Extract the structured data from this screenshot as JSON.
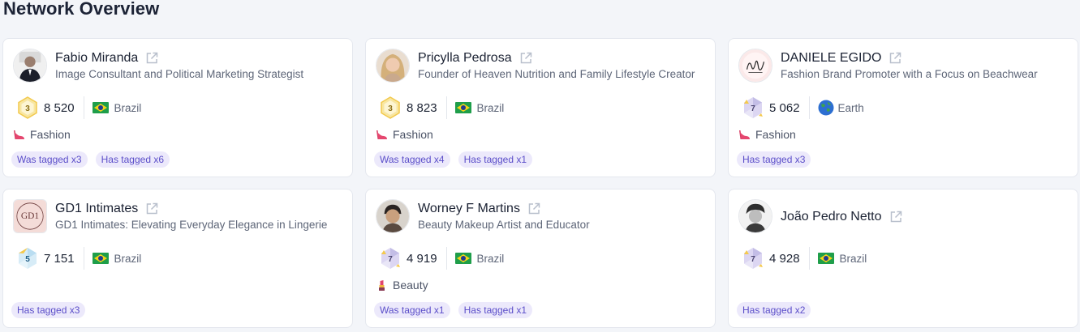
{
  "page": {
    "title": "Network Overview"
  },
  "colors": {
    "tag_bg": "#ece9fb",
    "tag_text": "#5b4ec9",
    "badge_gold": "#f2c94c"
  },
  "cards": [
    {
      "name": "Fabio Miranda",
      "bio": "Image Consultant and Political Marketing Strategist",
      "level": "3",
      "score": "8 520",
      "country": "Brazil",
      "country_icon": "brazil-flag-icon",
      "category": "Fashion",
      "category_icon": "heel-icon",
      "tags": [
        "Was tagged x3",
        "Has tagged x6"
      ]
    },
    {
      "name": "Pricylla Pedrosa",
      "bio": "Founder of Heaven Nutrition and Family Lifestyle Creator",
      "level": "3",
      "score": "8 823",
      "country": "Brazil",
      "country_icon": "brazil-flag-icon",
      "category": "Fashion",
      "category_icon": "heel-icon",
      "tags": [
        "Was tagged x4",
        "Has tagged x1"
      ]
    },
    {
      "name": "DANIELE EGIDO",
      "bio": "Fashion Brand Promoter with a Focus on Beachwear",
      "level": "7",
      "score": "5 062",
      "country": "Earth",
      "country_icon": "globe-icon",
      "category": "Fashion",
      "category_icon": "heel-icon",
      "tags": [
        "Has tagged x3"
      ]
    },
    {
      "name": "GD1 Intimates",
      "bio": "GD1 Intimates: Elevating Everyday Elegance in Lingerie",
      "level": "5",
      "score": "7 151",
      "country": "Brazil",
      "country_icon": "brazil-flag-icon",
      "category": "",
      "category_icon": "",
      "tags": [
        "Has tagged x3"
      ]
    },
    {
      "name": "Worney F Martins",
      "bio": "Beauty Makeup Artist and Educator",
      "level": "7",
      "score": "4 919",
      "country": "Brazil",
      "country_icon": "brazil-flag-icon",
      "category": "Beauty",
      "category_icon": "lipstick-icon",
      "tags": [
        "Was tagged x1",
        "Has tagged x1"
      ]
    },
    {
      "name": "João Pedro Netto",
      "bio": "",
      "level": "7",
      "score": "4 928",
      "country": "Brazil",
      "country_icon": "brazil-flag-icon",
      "category": "",
      "category_icon": "",
      "tags": [
        "Has tagged x2"
      ]
    }
  ]
}
